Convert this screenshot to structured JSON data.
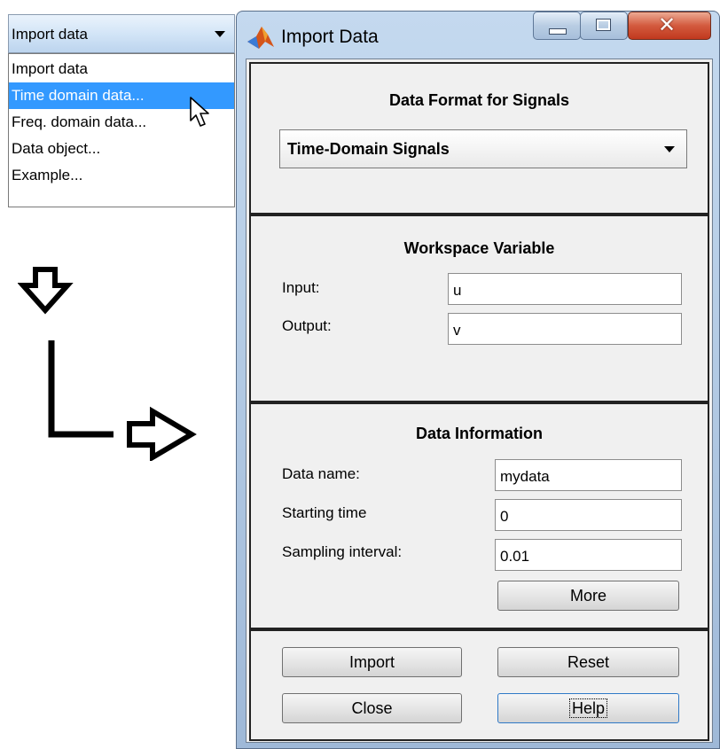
{
  "dropdown": {
    "selected": "Import data",
    "options": [
      "Import data",
      "Time domain data...",
      "Freq. domain data...",
      "Data object...",
      "Example..."
    ],
    "highlighted_index": 1
  },
  "window": {
    "title": "Import Data"
  },
  "format_panel": {
    "heading": "Data Format for Signals",
    "selected": "Time-Domain Signals"
  },
  "workspace_panel": {
    "heading": "Workspace Variable",
    "input_label": "Input:",
    "input_value": "u",
    "output_label": "Output:",
    "output_value": "v"
  },
  "info_panel": {
    "heading": "Data Information",
    "name_label": "Data name:",
    "name_value": "mydata",
    "start_label": "Starting time",
    "start_value": "0",
    "interval_label": "Sampling interval:",
    "interval_value": "0.01",
    "more_label": "More"
  },
  "actions": {
    "import_label": "Import",
    "reset_label": "Reset",
    "close_label": "Close",
    "help_label": "Help"
  },
  "colors": {
    "selection": "#3399ff",
    "panel_bg": "#f0f0f0",
    "close_button": "#c1391e"
  }
}
